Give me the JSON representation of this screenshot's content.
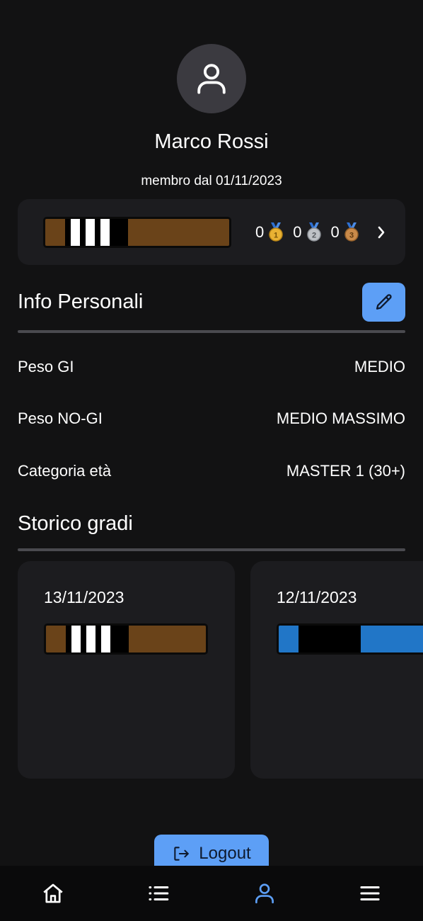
{
  "profile": {
    "name": "Marco Rossi",
    "member_since": "membro dal 01/11/2023",
    "avatar_icon": "user-icon"
  },
  "belt_summary": {
    "belt": {
      "base_color": "#6a4319",
      "bar_color": "#000000",
      "stripe_color": "#ffffff",
      "stripes": 3
    },
    "medals": [
      {
        "type": "gold",
        "count": "0",
        "number": "1",
        "ribbon": "#2d6fd1",
        "color": "#e9b233"
      },
      {
        "type": "silver",
        "count": "0",
        "number": "2",
        "ribbon": "#2d6fd1",
        "color": "#bfc2c6"
      },
      {
        "type": "bronze",
        "count": "0",
        "number": "3",
        "ribbon": "#2d6fd1",
        "color": "#c98a4a"
      }
    ],
    "chevron_icon": "chevron-right-icon"
  },
  "personal_info": {
    "title": "Info Personali",
    "edit_icon": "pencil-icon",
    "rows": [
      {
        "label": "Peso GI",
        "value": "MEDIO"
      },
      {
        "label": "Peso NO-GI",
        "value": "MEDIO MASSIMO"
      },
      {
        "label": "Categoria età",
        "value": "MASTER 1 (30+)"
      }
    ]
  },
  "history": {
    "title": "Storico gradi",
    "entries": [
      {
        "date": "13/11/2023",
        "belt": {
          "base_color": "#6a4319",
          "bar_color": "#000000",
          "stripe_color": "#ffffff",
          "stripes": 3
        }
      },
      {
        "date": "12/11/2023",
        "belt": {
          "base_color": "#2176c7",
          "bar_color": "#000000",
          "stripe_color": "#ffffff",
          "stripes": 0
        }
      }
    ]
  },
  "logout": {
    "label": "Logout",
    "icon": "logout-icon"
  },
  "navbar": {
    "items": [
      {
        "name": "home",
        "icon": "home-icon",
        "active": false
      },
      {
        "name": "list",
        "icon": "list-icon",
        "active": false
      },
      {
        "name": "profile",
        "icon": "user-icon",
        "active": true
      },
      {
        "name": "menu",
        "icon": "menu-icon",
        "active": false
      }
    ],
    "active_color": "#5d9ff6",
    "inactive_color": "#ffffff"
  },
  "theme": {
    "background": "#121213",
    "card": "#1c1c1f",
    "accent": "#5d9ff6"
  }
}
